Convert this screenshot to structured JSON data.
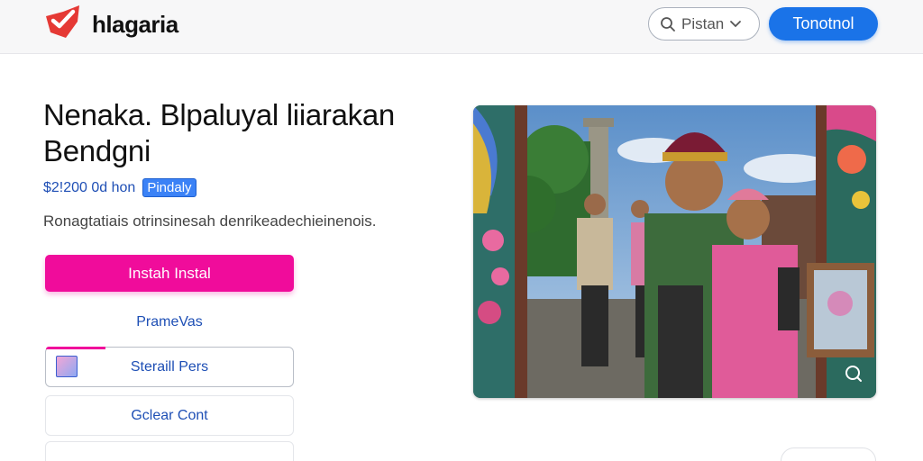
{
  "header": {
    "brand": "hlagaria",
    "search_label": "Pistan",
    "cta_label": "Tonotnol"
  },
  "listing": {
    "title": "Nenaka. Blpaluyal liiarakan Bendgni",
    "price": "$2!200 0d hon",
    "badge": "Pindaly",
    "description": "Ronagtatiais otrinsinesah denrikeadechieinenois."
  },
  "actions": {
    "install_label": "Instah Instal",
    "link_label": "PrameVas",
    "option1_label": "Steraill Pers",
    "option1_progress": 0.24,
    "option2_label": "Gclear Cont",
    "option3_label": ""
  },
  "colors": {
    "accent": "#f00c9b",
    "primary": "#1a73e8",
    "link": "#1e4fb5",
    "logo": "#e53935"
  },
  "icons": {
    "logo": "checkmark-logo-icon",
    "search": "search-icon",
    "dropdown": "chevron-down-icon",
    "expand": "expand-icon"
  }
}
